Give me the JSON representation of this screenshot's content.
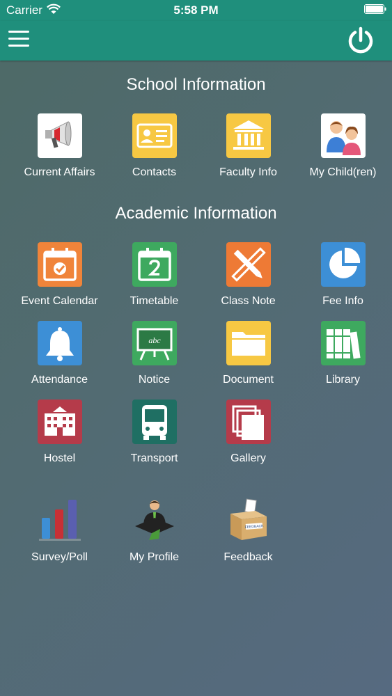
{
  "status_bar": {
    "carrier": "Carrier",
    "time": "5:58 PM"
  },
  "header": {
    "menu_icon": "hamburger-menu-icon",
    "power_icon": "power-icon"
  },
  "school_section": {
    "title": "School Information",
    "items": [
      {
        "label": "Current Affairs",
        "icon": "megaphone-icon",
        "color": "#ffffff"
      },
      {
        "label": "Contacts",
        "icon": "contact-card-icon",
        "color": "#f7c843"
      },
      {
        "label": "Faculty Info",
        "icon": "building-icon",
        "color": "#f7c843"
      },
      {
        "label": "My Child(ren)",
        "icon": "children-icon",
        "color": "#ffffff"
      }
    ]
  },
  "academic_section": {
    "title": "Academic Information",
    "items": [
      {
        "label": "Event Calendar",
        "icon": "calendar-check-icon",
        "color": "#f0843a"
      },
      {
        "label": "Timetable",
        "icon": "calendar-day-icon",
        "color": "#3ea95f"
      },
      {
        "label": "Class Note",
        "icon": "ruler-pencil-icon",
        "color": "#ee7a35"
      },
      {
        "label": "Fee Info",
        "icon": "pie-chart-icon",
        "color": "#3d8fd6"
      },
      {
        "label": "Attendance",
        "icon": "bell-icon",
        "color": "#3d8fd6"
      },
      {
        "label": "Notice",
        "icon": "chalkboard-icon",
        "color": "#3ea95f"
      },
      {
        "label": "Document",
        "icon": "folder-icon",
        "color": "#f7c843"
      },
      {
        "label": "Library",
        "icon": "books-icon",
        "color": "#3ea95f"
      },
      {
        "label": "Hostel",
        "icon": "hostel-building-icon",
        "color": "#b53b4a"
      },
      {
        "label": "Transport",
        "icon": "bus-icon",
        "color": "#1f6f63"
      },
      {
        "label": "Gallery",
        "icon": "gallery-icon",
        "color": "#b53b4a"
      },
      {
        "label": "Survey/Poll",
        "icon": "bar-chart-icon",
        "color": ""
      },
      {
        "label": "My Profile",
        "icon": "profile-icon",
        "color": ""
      },
      {
        "label": "Feedback",
        "icon": "feedback-box-icon",
        "color": ""
      }
    ]
  }
}
